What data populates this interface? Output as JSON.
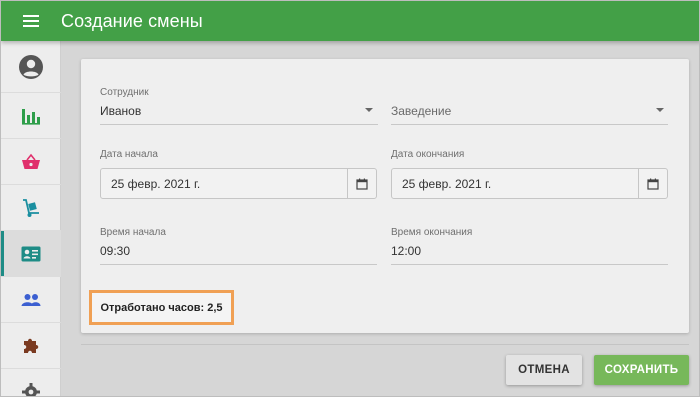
{
  "appbar": {
    "title": "Создание смены"
  },
  "sidebar": {
    "items": [
      {
        "name": "user-icon",
        "color": "#555555"
      },
      {
        "name": "bar-chart-icon",
        "color": "#2e9e4a"
      },
      {
        "name": "basket-icon",
        "color": "#e0306c"
      },
      {
        "name": "hand-truck-icon",
        "color": "#1a8fa0"
      },
      {
        "name": "id-card-icon",
        "color": "#1e8c86",
        "active": true
      },
      {
        "name": "people-icon",
        "color": "#3b5fd1"
      },
      {
        "name": "puzzle-icon",
        "color": "#7a3a20"
      },
      {
        "name": "gear-icon",
        "color": "#555555"
      }
    ]
  },
  "form": {
    "employee": {
      "label": "Сотрудник",
      "value": "Иванов"
    },
    "venue": {
      "placeholder": "Заведение"
    },
    "start_date": {
      "label": "Дата начала",
      "value": "25 февр. 2021 г."
    },
    "end_date": {
      "label": "Дата окончания",
      "value": "25 февр. 2021 г."
    },
    "start_time": {
      "label": "Время начала",
      "value": "09:30"
    },
    "end_time": {
      "label": "Время окончания",
      "value": "12:00"
    },
    "hours_worked": "Отработано часов: 2,5"
  },
  "actions": {
    "cancel": "ОТМЕНА",
    "save": "СОХРАНИТЬ"
  },
  "colors": {
    "appbar": "#43a047",
    "save_button": "#77b85a",
    "highlight_border": "#f0a054",
    "active_indicator": "#1e8c86"
  }
}
